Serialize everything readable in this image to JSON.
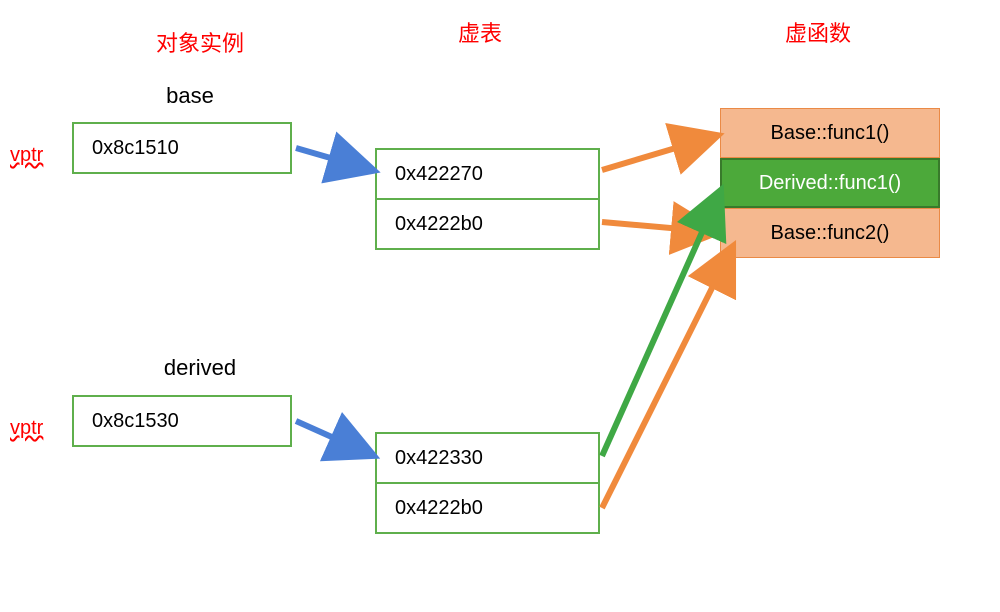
{
  "headers": {
    "col1": "对象实例",
    "col2": "虚表",
    "col3": "虚函数"
  },
  "vptr_label": "vptr",
  "objects": {
    "base": {
      "name": "base",
      "vptr_value": "0x8c1510",
      "vtable": [
        "0x422270",
        "0x4222b0"
      ]
    },
    "derived": {
      "name": "derived",
      "vptr_value": "0x8c1530",
      "vtable": [
        "0x422330",
        "0x4222b0"
      ]
    }
  },
  "functions": {
    "base_func1": "Base::func1()",
    "derived_func1": "Derived::func1()",
    "base_func2": "Base::func2()"
  },
  "colors": {
    "header_red": "#ff0000",
    "box_border_green": "#5faf4c",
    "arrow_blue": "#4a7fd6",
    "arrow_orange": "#f08a3c",
    "arrow_green": "#3fa845",
    "func_orange_bg": "#f5b88f",
    "func_green_bg": "#4ca93a"
  }
}
